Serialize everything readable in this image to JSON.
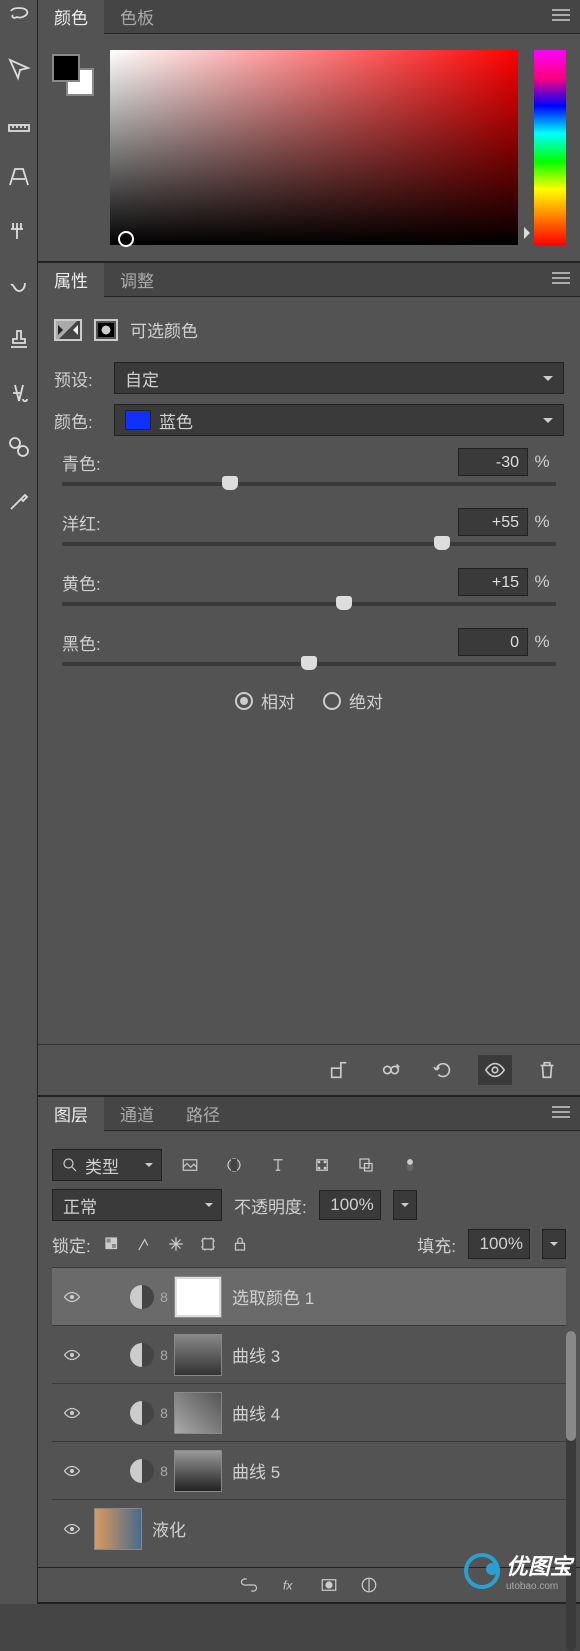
{
  "color_panel": {
    "tabs": [
      "颜色",
      "色板"
    ],
    "active_tab": 0
  },
  "properties_panel": {
    "tabs": [
      "属性",
      "调整"
    ],
    "active_tab": 0,
    "title": "可选颜色",
    "preset_label": "预设:",
    "preset_value": "自定",
    "color_label": "颜色:",
    "color_value": "蓝色",
    "color_hex": "#1030ff",
    "sliders": [
      {
        "name": "青色:",
        "value": "-30",
        "unit": "%",
        "pos": 34
      },
      {
        "name": "洋红:",
        "value": "+55",
        "unit": "%",
        "pos": 77
      },
      {
        "name": "黄色:",
        "value": "+15",
        "unit": "%",
        "pos": 57
      },
      {
        "name": "黑色:",
        "value": "0",
        "unit": "%",
        "pos": 50
      }
    ],
    "method": {
      "relative": "相对",
      "absolute": "绝对",
      "selected": "relative"
    }
  },
  "layers_panel": {
    "tabs": [
      "图层",
      "通道",
      "路径"
    ],
    "active_tab": 0,
    "search_kind": "类型",
    "blend_mode": "正常",
    "opacity_label": "不透明度:",
    "opacity_value": "100%",
    "lock_label": "锁定:",
    "fill_label": "填充:",
    "fill_value": "100%",
    "layers": [
      {
        "name": "选取颜色 1",
        "type": "adjust",
        "thumb": "white",
        "selected": true,
        "visible": true,
        "indent": true
      },
      {
        "name": "曲线 3",
        "type": "adjust",
        "thumb": "img1",
        "selected": false,
        "visible": true,
        "indent": true
      },
      {
        "name": "曲线 4",
        "type": "adjust",
        "thumb": "img2",
        "selected": false,
        "visible": true,
        "indent": true
      },
      {
        "name": "曲线 5",
        "type": "adjust",
        "thumb": "img3",
        "selected": false,
        "visible": true,
        "indent": true
      },
      {
        "name": "液化",
        "type": "image",
        "thumb": "",
        "selected": false,
        "visible": true,
        "indent": false
      }
    ]
  },
  "watermark": {
    "text": "优图宝",
    "sub": "utobao.com"
  }
}
